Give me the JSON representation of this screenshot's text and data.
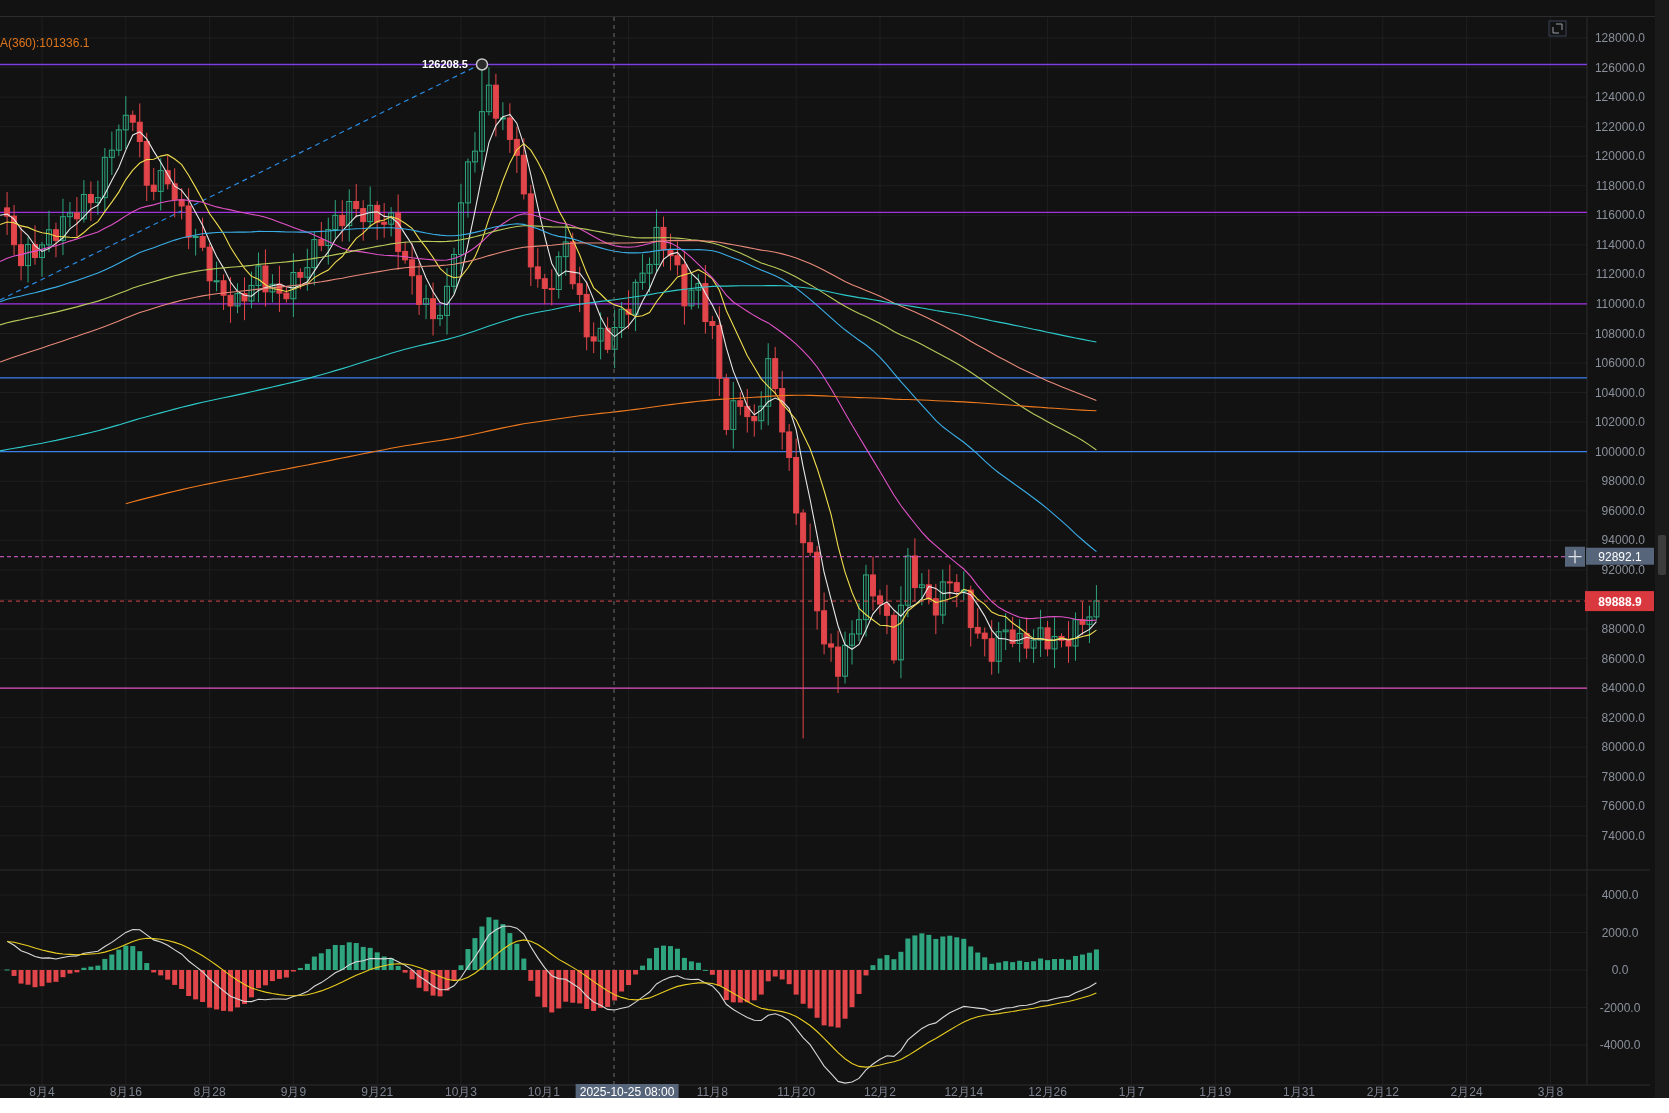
{
  "legend": {
    "text": "A(360):101336.1"
  },
  "peak_label": "126208.5",
  "price_axis_upper": [
    "128000.0",
    "126000.0",
    "124000.0",
    "122000.0",
    "120000.0",
    "118000.0",
    "116000.0",
    "114000.0",
    "112000.0",
    "110000.0",
    "108000.0",
    "106000.0",
    "104000.0",
    "102000.0",
    "100000.0",
    "98000.0",
    "96000.0",
    "94000.0",
    "92000.0"
  ],
  "price_axis_lower": [
    "88000.0",
    "86000.0",
    "84000.0",
    "82000.0",
    "80000.0",
    "78000.0",
    "76000.0",
    "74000.0"
  ],
  "price_markers": [
    {
      "kind": "crosshair",
      "text": "92892.1"
    },
    {
      "kind": "last",
      "text": "89888.9"
    }
  ],
  "macd_axis": [
    "4000.0",
    "2000.0",
    "0.0",
    "-2000.0",
    "-4000.0"
  ],
  "time_axis": [
    {
      "kind": "tick",
      "text": "8月4"
    },
    {
      "kind": "tick",
      "text": "8月16"
    },
    {
      "kind": "tick",
      "text": "8月28"
    },
    {
      "kind": "tick",
      "text": "9月9"
    },
    {
      "kind": "tick",
      "text": "9月21"
    },
    {
      "kind": "tick",
      "text": "10月3"
    },
    {
      "kind": "partial",
      "text": "10月1"
    },
    {
      "kind": "crosshair",
      "text": "2025-10-25 08:00"
    },
    {
      "kind": "tick",
      "text": "11月8"
    },
    {
      "kind": "tick",
      "text": "11月20"
    },
    {
      "kind": "tick",
      "text": "12月2"
    },
    {
      "kind": "tick",
      "text": "12月14"
    },
    {
      "kind": "tick",
      "text": "12月26"
    },
    {
      "kind": "tick",
      "text": "1月7"
    },
    {
      "kind": "tick",
      "text": "1月19"
    },
    {
      "kind": "tick",
      "text": "1月31"
    },
    {
      "kind": "tick",
      "text": "2月12"
    },
    {
      "kind": "tick",
      "text": "2月24"
    },
    {
      "kind": "tick",
      "text": "3月8"
    }
  ]
}
